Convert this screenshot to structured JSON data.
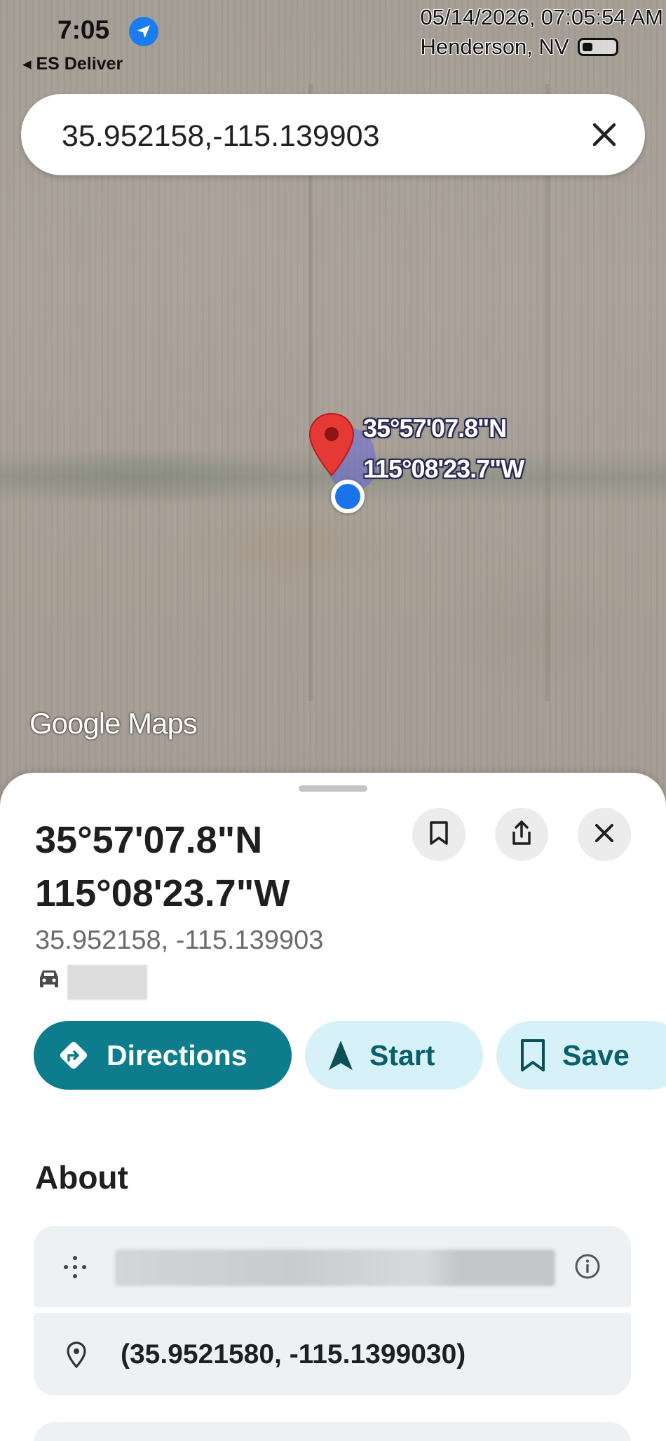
{
  "status": {
    "time": "7:05",
    "back_app": "◂ ES Deliver"
  },
  "stamp": {
    "datetime": "05/14/2026, 07:05:54 AM",
    "location": "Henderson, NV"
  },
  "search": {
    "value": "35.952158,-115.139903"
  },
  "map": {
    "pin_label_lat": "35°57'07.8\"N",
    "pin_label_lng": "115°08'23.7\"W",
    "logo": "Google Maps"
  },
  "place": {
    "title_line1": "35°57'07.8\"N",
    "title_line2": "115°08'23.7\"W",
    "coords": "35.952158, -115.139903"
  },
  "actions": {
    "directions": "Directions",
    "start": "Start",
    "save": "Save"
  },
  "about": {
    "heading": "About",
    "coords_precise": "(35.9521580, -115.1399030)"
  },
  "colors": {
    "accent": "#0d7c8c",
    "secondary_pill": "#d6f1f8",
    "pin": "#e53935",
    "location_dot": "#1a73e8"
  },
  "icons": [
    "location-arrow-icon",
    "battery-icon",
    "close-icon",
    "map-pin-icon",
    "bookmark-icon",
    "share-icon",
    "car-icon",
    "directions-icon",
    "navigation-arrow-icon",
    "plus-code-icon",
    "info-icon",
    "pinpoint-icon"
  ]
}
